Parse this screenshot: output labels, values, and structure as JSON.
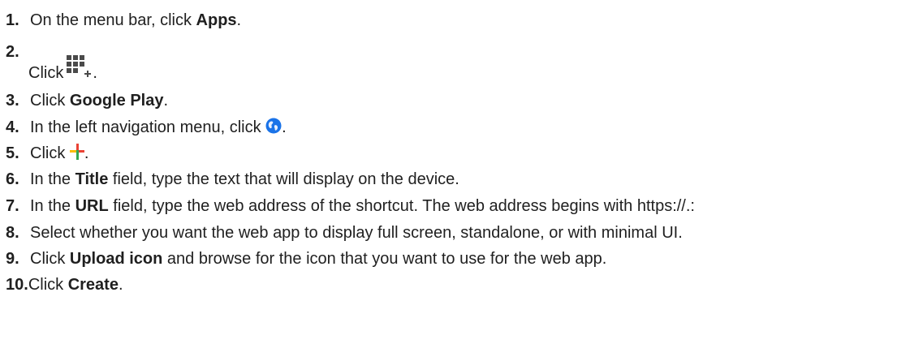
{
  "steps": [
    {
      "number": "1.",
      "before": "On the menu bar, click ",
      "bold": "Apps",
      "after": "."
    },
    {
      "number": "2.",
      "text": "Click",
      "icon": "apps-plus-icon",
      "after": "."
    },
    {
      "number": "3.",
      "before": "Click ",
      "bold": "Google Play",
      "after": "."
    },
    {
      "number": "4.",
      "before": "In the left navigation menu, click ",
      "icon": "globe-icon",
      "after": "."
    },
    {
      "number": "5.",
      "before": "Click ",
      "icon": "colored-plus-icon",
      "after": "."
    },
    {
      "number": "6.",
      "before": "In the ",
      "bold": "Title",
      "after": " field, type the text that will display on the device."
    },
    {
      "number": "7.",
      "before": "In the ",
      "bold": "URL",
      "after": " field, type the web address of the shortcut. The web address begins with https://.:"
    },
    {
      "number": "8.",
      "text": "Select whether you want the web app to display full screen, standalone, or with minimal UI."
    },
    {
      "number": "9.",
      "before": "Click ",
      "bold": "Upload icon",
      "after": " and browse for the icon that you want to use for the web app."
    },
    {
      "number": "10.",
      "before": "Click ",
      "bold": "Create",
      "after": "."
    }
  ],
  "colors": {
    "text": "#1f1f1f",
    "globe_blue": "#1a73e8",
    "plus_red": "#ea4335",
    "plus_yellow": "#fbbc04",
    "plus_green": "#34a853",
    "plus_blue": "#4285f4"
  }
}
